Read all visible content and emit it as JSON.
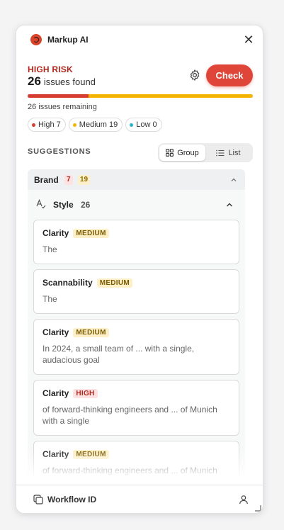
{
  "app": {
    "title": "Markup AI"
  },
  "summary": {
    "risk_label": "HIGH RISK",
    "issue_count": "26",
    "issue_suffix": "issues found",
    "remaining": "26 issues remaining",
    "check_label": "Check",
    "progress": {
      "high_fraction": 0.27,
      "medium_fraction": 0.73
    }
  },
  "filters": [
    {
      "label": "High 7",
      "color": "#d63c2f"
    },
    {
      "label": "Medium 19",
      "color": "#f4b400"
    },
    {
      "label": "Low 0",
      "color": "#2bb3c9"
    }
  ],
  "suggestions": {
    "title": "SUGGESTIONS",
    "view_toggle": {
      "group": "Group",
      "list": "List",
      "active": "group"
    },
    "group": {
      "label": "Brand",
      "high_count": "7",
      "medium_count": "19",
      "subgroup": {
        "label": "Style",
        "count": "26"
      },
      "cards": [
        {
          "title": "Clarity",
          "severity": "MEDIUM",
          "text": "The"
        },
        {
          "title": "Scannability",
          "severity": "MEDIUM",
          "text": "The"
        },
        {
          "title": "Clarity",
          "severity": "MEDIUM",
          "text": "In 2024, a small team of ... with a single, audacious goal"
        },
        {
          "title": "Clarity",
          "severity": "HIGH",
          "text": "of forward-thinking engineers and ... of Munich with a single"
        },
        {
          "title": "Clarity",
          "severity": "MEDIUM",
          "text": "of forward-thinking engineers and ... of Munich with a single"
        }
      ]
    }
  },
  "footer": {
    "workflow_label": "Workflow ID"
  },
  "colors": {
    "accent": "#e0453a",
    "high": "#d63c2f",
    "medium": "#f4b400",
    "low": "#2bb3c9"
  }
}
